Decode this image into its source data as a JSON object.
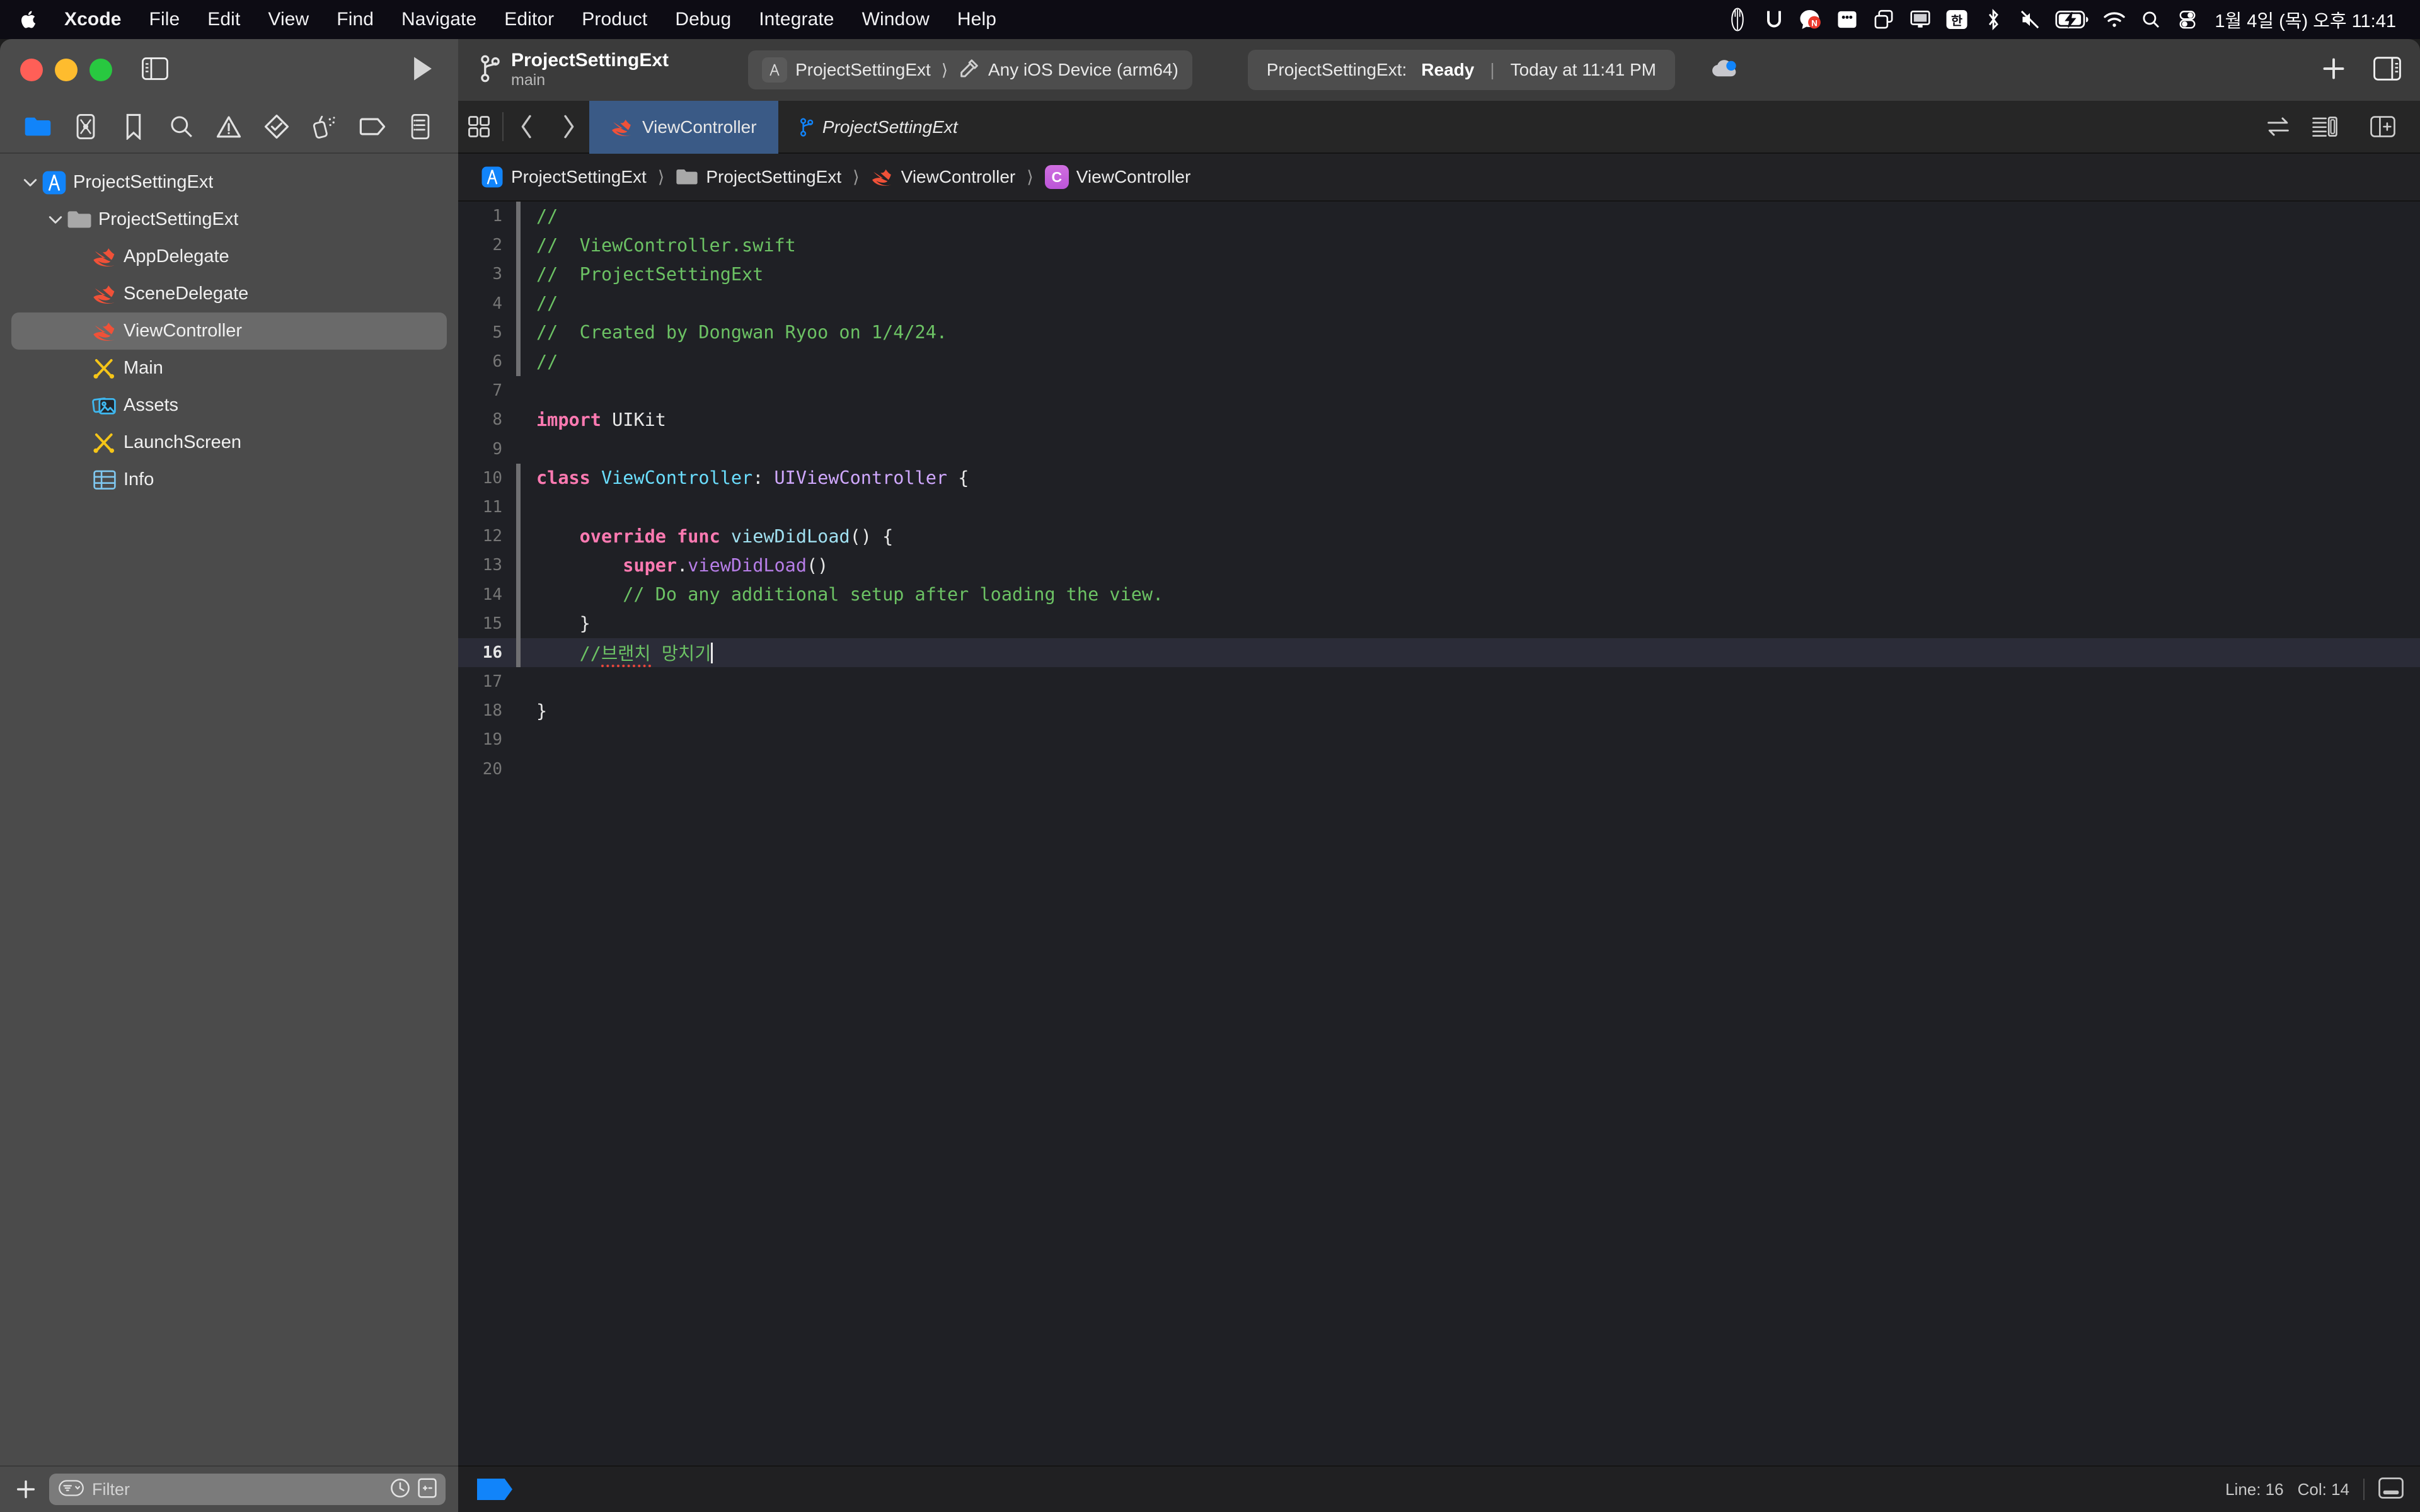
{
  "menubar": {
    "apple_icon": "apple-logo-icon",
    "items": [
      "Xcode",
      "File",
      "Edit",
      "View",
      "Find",
      "Navigate",
      "Editor",
      "Product",
      "Debug",
      "Integrate",
      "Window",
      "Help"
    ],
    "status_icons": [
      "fork-knife-icon",
      "magnet-icon",
      "naver-whale-icon",
      "dots-app-icon",
      "window-stack-icon",
      "display-icon",
      "korean-input-icon",
      "bluetooth-icon",
      "mute-icon",
      "battery-charging-icon",
      "wifi-icon",
      "spotlight-search-icon",
      "control-center-icon"
    ],
    "clock": "1월 4일 (목) 오후 11:41"
  },
  "toolbar": {
    "traffic_lights": [
      "close-button",
      "minimize-button",
      "zoom-button"
    ],
    "sidebar_toggle_icon": "toggle-navigator-icon",
    "run_icon": "run-play-icon",
    "branch": {
      "icon": "source-control-branch-icon",
      "title": "ProjectSettingExt",
      "subtitle": "main"
    },
    "scheme": {
      "app_icon": "xcode-app-icon",
      "scheme_name": "ProjectSettingExt",
      "separator": "⟩",
      "destination_icon": "hammer-icon",
      "destination": "Any iOS Device (arm64)"
    },
    "status": {
      "project": "ProjectSettingExt:",
      "state": "Ready",
      "separator": "|",
      "time": "Today at 11:41 PM"
    },
    "cloud_icon": "cloud-status-icon",
    "add_icon": "add-plus-icon",
    "inspector_toggle_icon": "toggle-inspector-icon"
  },
  "navigator": {
    "tabs": [
      {
        "name": "project-navigator",
        "icon": "folder-icon",
        "active": true
      },
      {
        "name": "source-control-navigator",
        "icon": "source-control-icon",
        "active": false
      },
      {
        "name": "bookmark-navigator",
        "icon": "bookmark-icon",
        "active": false
      },
      {
        "name": "find-navigator",
        "icon": "search-icon",
        "active": false
      },
      {
        "name": "issue-navigator",
        "icon": "warning-triangle-icon",
        "active": false
      },
      {
        "name": "test-navigator",
        "icon": "diamond-check-icon",
        "active": false
      },
      {
        "name": "debug-navigator",
        "icon": "spray-can-icon",
        "active": false
      },
      {
        "name": "breakpoint-navigator",
        "icon": "tag-icon",
        "active": false
      },
      {
        "name": "report-navigator",
        "icon": "report-list-icon",
        "active": false
      }
    ],
    "tree": [
      {
        "label": "ProjectSettingExt",
        "icon": "xcode-project-icon",
        "indent": 0,
        "disclosure": "open",
        "selected": false
      },
      {
        "label": "ProjectSettingExt",
        "icon": "folder-group-icon",
        "indent": 1,
        "disclosure": "open",
        "selected": false
      },
      {
        "label": "AppDelegate",
        "icon": "swift-file-icon",
        "indent": 2,
        "disclosure": "",
        "selected": false
      },
      {
        "label": "SceneDelegate",
        "icon": "swift-file-icon",
        "indent": 2,
        "disclosure": "",
        "selected": false
      },
      {
        "label": "ViewController",
        "icon": "swift-file-icon",
        "indent": 2,
        "disclosure": "",
        "selected": true
      },
      {
        "label": "Main",
        "icon": "storyboard-icon",
        "indent": 2,
        "disclosure": "",
        "selected": false
      },
      {
        "label": "Assets",
        "icon": "assets-catalog-icon",
        "indent": 2,
        "disclosure": "",
        "selected": false
      },
      {
        "label": "LaunchScreen",
        "icon": "storyboard-icon",
        "indent": 2,
        "disclosure": "",
        "selected": false
      },
      {
        "label": "Info",
        "icon": "plist-icon",
        "indent": 2,
        "disclosure": "",
        "selected": false
      }
    ],
    "filter": {
      "add_label": "+",
      "filter_icon": "filter-dropdown-icon",
      "placeholder": "Filter",
      "recent_icon": "recent-clock-icon",
      "scm_icon": "source-control-filter-icon"
    }
  },
  "editor": {
    "tabbar": {
      "grid_icon": "tab-overview-icon",
      "back_icon": "navigate-back-icon",
      "forward_icon": "navigate-forward-icon",
      "tabs": [
        {
          "label": "ViewController",
          "icon": "swift-file-icon",
          "active": true,
          "italic": false
        },
        {
          "label": "ProjectSettingExt",
          "icon": "source-control-branch-icon",
          "active": false,
          "italic": true
        }
      ],
      "right_icons": [
        "compare-swap-icon",
        "minimap-toggle-icon",
        "add-editor-icon"
      ]
    },
    "breadcrumb": [
      {
        "label": "ProjectSettingExt",
        "icon": "xcode-project-icon"
      },
      {
        "label": "ProjectSettingExt",
        "icon": "folder-group-icon"
      },
      {
        "label": "ViewController",
        "icon": "swift-file-icon"
      },
      {
        "label": "ViewController",
        "icon": "class-badge-icon"
      }
    ],
    "code": {
      "language": "swift",
      "lines": [
        {
          "n": "1",
          "changed": true,
          "current": false,
          "tokens": [
            {
              "t": "//",
              "c": "c-comment"
            }
          ]
        },
        {
          "n": "2",
          "changed": true,
          "current": false,
          "tokens": [
            {
              "t": "//  ViewController.swift",
              "c": "c-comment"
            }
          ]
        },
        {
          "n": "3",
          "changed": true,
          "current": false,
          "tokens": [
            {
              "t": "//  ProjectSettingExt",
              "c": "c-comment"
            }
          ]
        },
        {
          "n": "4",
          "changed": true,
          "current": false,
          "tokens": [
            {
              "t": "//",
              "c": "c-comment"
            }
          ]
        },
        {
          "n": "5",
          "changed": true,
          "current": false,
          "tokens": [
            {
              "t": "//  Created by Dongwan Ryoo on 1/4/24.",
              "c": "c-comment"
            }
          ]
        },
        {
          "n": "6",
          "changed": true,
          "current": false,
          "tokens": [
            {
              "t": "//",
              "c": "c-comment"
            }
          ]
        },
        {
          "n": "7",
          "changed": false,
          "current": false,
          "tokens": []
        },
        {
          "n": "8",
          "changed": false,
          "current": false,
          "tokens": [
            {
              "t": "import",
              "c": "c-keyword"
            },
            {
              "t": " ",
              "c": "c-plain"
            },
            {
              "t": "UIKit",
              "c": "c-plain"
            }
          ]
        },
        {
          "n": "9",
          "changed": false,
          "current": false,
          "tokens": []
        },
        {
          "n": "10",
          "changed": true,
          "current": false,
          "tokens": [
            {
              "t": "class",
              "c": "c-keyword"
            },
            {
              "t": " ",
              "c": "c-plain"
            },
            {
              "t": "ViewController",
              "c": "c-type"
            },
            {
              "t": ": ",
              "c": "c-plain"
            },
            {
              "t": "UIViewController",
              "c": "c-usertype"
            },
            {
              "t": " {",
              "c": "c-plain"
            }
          ]
        },
        {
          "n": "11",
          "changed": true,
          "current": false,
          "tokens": []
        },
        {
          "n": "12",
          "changed": true,
          "current": false,
          "tokens": [
            {
              "t": "    ",
              "c": "c-plain"
            },
            {
              "t": "override",
              "c": "c-keyword"
            },
            {
              "t": " ",
              "c": "c-plain"
            },
            {
              "t": "func",
              "c": "c-keyword"
            },
            {
              "t": " ",
              "c": "c-plain"
            },
            {
              "t": "viewDidLoad",
              "c": "c-method"
            },
            {
              "t": "() {",
              "c": "c-plain"
            }
          ]
        },
        {
          "n": "13",
          "changed": true,
          "current": false,
          "tokens": [
            {
              "t": "        ",
              "c": "c-plain"
            },
            {
              "t": "super",
              "c": "c-keyword"
            },
            {
              "t": ".",
              "c": "c-plain"
            },
            {
              "t": "viewDidLoad",
              "c": "c-call"
            },
            {
              "t": "()",
              "c": "c-plain"
            }
          ]
        },
        {
          "n": "14",
          "changed": true,
          "current": false,
          "tokens": [
            {
              "t": "        // Do any additional setup after loading the view.",
              "c": "c-comment"
            }
          ]
        },
        {
          "n": "15",
          "changed": true,
          "current": false,
          "tokens": [
            {
              "t": "    }",
              "c": "c-plain"
            }
          ]
        },
        {
          "n": "16",
          "changed": true,
          "current": true,
          "tokens": [
            {
              "t": "    //",
              "c": "c-comment"
            },
            {
              "t": "브랜치",
              "c": "c-comment",
              "misspelled": true
            },
            {
              "t": " 망치기",
              "c": "c-comment"
            }
          ],
          "caret": true
        },
        {
          "n": "17",
          "changed": false,
          "current": false,
          "tokens": []
        },
        {
          "n": "18",
          "changed": false,
          "current": false,
          "tokens": [
            {
              "t": "}",
              "c": "c-plain"
            }
          ]
        },
        {
          "n": "19",
          "changed": false,
          "current": false,
          "tokens": []
        },
        {
          "n": "20",
          "changed": false,
          "current": false,
          "tokens": []
        }
      ]
    }
  },
  "status_bar": {
    "breakpoint_indicator": "breakpoint-enabled-icon",
    "line_label": "Line: 16",
    "col_label": "Col: 14",
    "console_toggle_icon": "toggle-console-icon"
  },
  "colors": {
    "accent_blue": "#1184fa",
    "tab_active": "#3a5a86",
    "swift_orange": "#f05138",
    "comment_green": "#6cc264",
    "keyword_pink": "#ff7ab2",
    "type_cyan": "#6bdfff",
    "usertype_purple": "#d0a8ff",
    "misspell_red": "#e8463a",
    "editor_bg": "#1f2025",
    "navigator_bg": "#4b4b4b",
    "menubar_bg": "#0d0c14"
  }
}
